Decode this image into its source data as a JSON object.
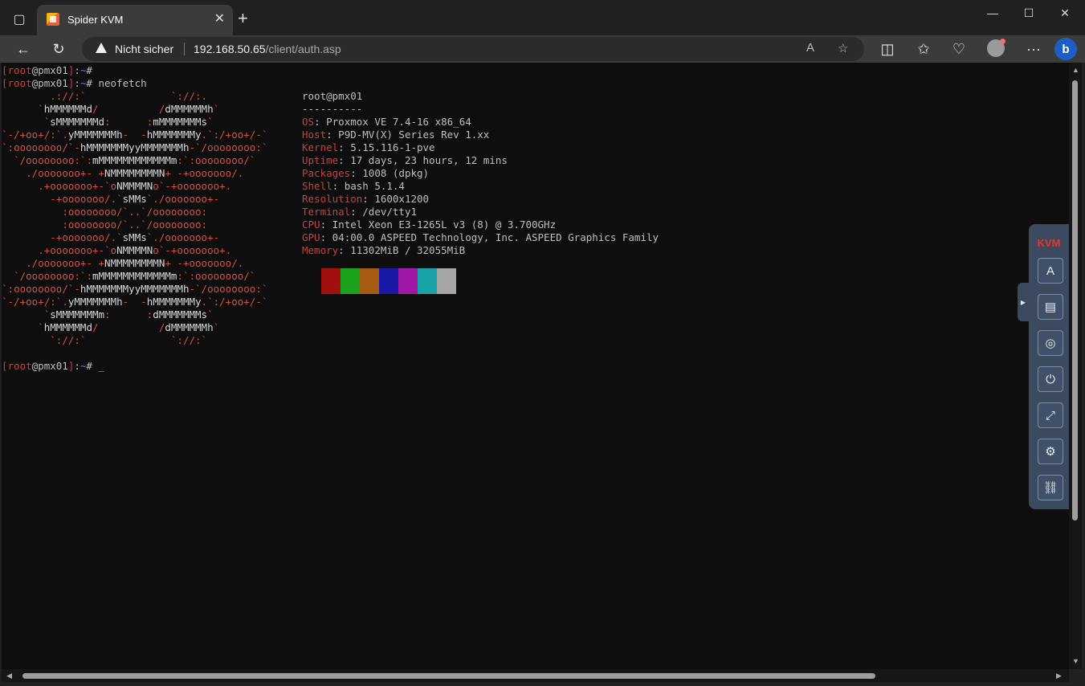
{
  "browser": {
    "tab_title": "Spider KVM",
    "security_label": "Nicht sicher",
    "url_host": "192.168.50.65",
    "url_path": "/client/auth.asp"
  },
  "terminal": {
    "prompt1": {
      "user": "root",
      "host": "pmx01",
      "cmd": ""
    },
    "prompt2": {
      "user": "root",
      "host": "pmx01",
      "cmd": "neofetch"
    },
    "prompt3": {
      "user": "root",
      "host": "pmx01",
      "cmd": "_"
    },
    "ascii_logo": [
      "        .://:`              `://:.",
      "      `hMMMMMMd/          /dMMMMMMh`",
      "       `sMMMMMMMd:      :mMMMMMMMs`",
      "`-/+oo+/:`.yMMMMMMMh-  -hMMMMMMMy.`:/+oo+/-`",
      "`:oooooooo/`-hMMMMMMMyyMMMMMMMh-`/oooooooo:`",
      "  `/oooooooo:`:mMMMMMMMMMMMMm:`:oooooooo/`",
      "    ./ooooooo+- +NMMMMMMMMN+ -+ooooooo/.",
      "      .+ooooooo+-`oNMMMMNo`-+ooooooo+.",
      "        -+ooooooo/.`sMMs`./ooooooo+-",
      "          :oooooooo/`..`/oooooooo:",
      "          :oooooooo/`..`/oooooooo:",
      "        -+ooooooo/.`sMMs`./ooooooo+-",
      "      .+ooooooo+-`oNMMMMNo`-+ooooooo+.",
      "    ./ooooooo+- +NMMMMMMMMN+ -+ooooooo/.",
      "  `/oooooooo:`:mMMMMMMMMMMMMm:`:oooooooo/`",
      "`:oooooooo/`-hMMMMMMMyyMMMMMMMh-`/oooooooo:`",
      "`-/+oo+/:`.yMMMMMMMh-  -hMMMMMMMy.`:/+oo+/-`",
      "       `sMMMMMMMm:      :dMMMMMMMs`",
      "      `hMMMMMMd/          /dMMMMMMh`",
      "        `://:`              `://:`"
    ],
    "info_title": "root@pmx01",
    "info_rule": "----------",
    "info": [
      {
        "key": "OS",
        "value": "Proxmox VE 7.4-16 x86_64"
      },
      {
        "key": "Host",
        "value": "P9D-MV(X) Series Rev 1.xx"
      },
      {
        "key": "Kernel",
        "value": "5.15.116-1-pve"
      },
      {
        "key": "Uptime",
        "value": "17 days, 23 hours, 12 mins"
      },
      {
        "key": "Packages",
        "value": "1008 (dpkg)"
      },
      {
        "key": "Shell",
        "value": "bash 5.1.4"
      },
      {
        "key": "Resolution",
        "value": "1600x1200"
      },
      {
        "key": "Terminal",
        "value": "/dev/tty1"
      },
      {
        "key": "CPU",
        "value": "Intel Xeon E3-1265L v3 (8) @ 3.700GHz"
      },
      {
        "key": "GPU",
        "value": "04:00.0 ASPEED Technology, Inc. ASPEED Graphics Family"
      },
      {
        "key": "Memory",
        "value": "11302MiB / 32055MiB"
      }
    ],
    "palette": [
      "#a10f0f",
      "#1ba31b",
      "#a65a12",
      "#1a18a6",
      "#a118a6",
      "#18a3a6",
      "#a6a6a6"
    ]
  },
  "kvm": {
    "logo": "KVM",
    "buttons": [
      {
        "name": "keyboard-button",
        "icon": "keyboard-icon",
        "glyph": "A"
      },
      {
        "name": "virtual-media-button",
        "icon": "media-icon",
        "glyph": "▤"
      },
      {
        "name": "record-button",
        "icon": "record-icon",
        "glyph": "◎"
      },
      {
        "name": "power-button",
        "icon": "power-icon",
        "glyph": "⏻"
      },
      {
        "name": "fullscreen-button",
        "icon": "fullscreen-icon",
        "glyph": "⤢"
      },
      {
        "name": "settings-button",
        "icon": "gear-icon",
        "glyph": "⚙"
      },
      {
        "name": "disconnect-button",
        "icon": "unlink-icon",
        "glyph": "⛓"
      }
    ]
  }
}
